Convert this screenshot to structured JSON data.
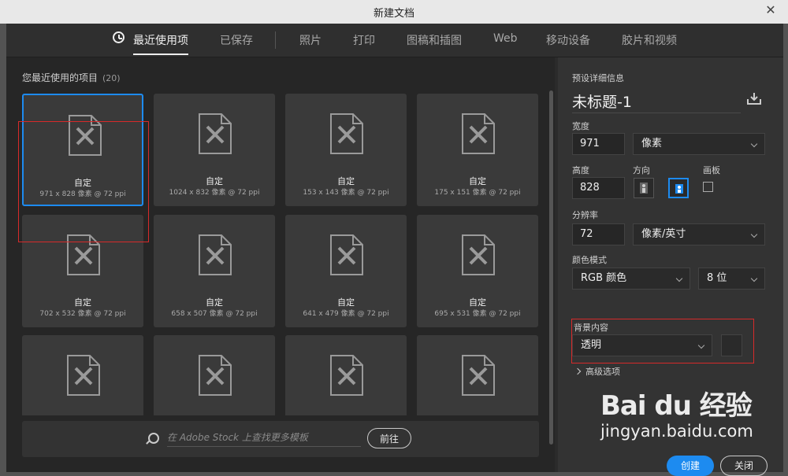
{
  "window": {
    "title": "新建文档",
    "close_glyph": "✕"
  },
  "tabs": [
    {
      "label": "最近使用项",
      "active": true
    },
    {
      "label": "已保存"
    },
    {
      "label": "照片"
    },
    {
      "label": "打印"
    },
    {
      "label": "图稿和插图"
    },
    {
      "label": "Web"
    },
    {
      "label": "移动设备"
    },
    {
      "label": "胶片和视频"
    }
  ],
  "recent": {
    "title": "您最近使用的项目",
    "count": "(20)",
    "items": [
      {
        "name": "自定",
        "info": "971 x 828 像素 @ 72 ppi"
      },
      {
        "name": "自定",
        "info": "1024 x 832 像素 @ 72 ppi"
      },
      {
        "name": "自定",
        "info": "153 x 143 像素 @ 72 ppi"
      },
      {
        "name": "自定",
        "info": "175 x 151 像素 @ 72 ppi"
      },
      {
        "name": "自定",
        "info": "702 x 532 像素 @ 72 ppi"
      },
      {
        "name": "自定",
        "info": "658 x 507 像素 @ 72 ppi"
      },
      {
        "name": "自定",
        "info": "641 x 479 像素 @ 72 ppi"
      },
      {
        "name": "自定",
        "info": "695 x 531 像素 @ 72 ppi"
      },
      {
        "name": "",
        "info": ""
      },
      {
        "name": "",
        "info": ""
      },
      {
        "name": "",
        "info": ""
      },
      {
        "name": "",
        "info": ""
      }
    ]
  },
  "stock": {
    "placeholder": "在 Adobe Stock 上查找更多模板",
    "go_label": "前往"
  },
  "preset": {
    "section_label": "预设详细信息",
    "doc_title": "未标题-1",
    "width_label": "宽度",
    "width_value": "971",
    "width_unit": "像素",
    "height_label": "高度",
    "height_value": "828",
    "orientation_label": "方向",
    "artboard_label": "画板",
    "resolution_label": "分辨率",
    "resolution_value": "72",
    "resolution_unit": "像素/英寸",
    "color_mode_label": "颜色模式",
    "color_mode_value": "RGB 颜色",
    "bit_depth_value": "8 位",
    "background_label": "背景内容",
    "background_value": "透明",
    "advanced_label": "高级选项"
  },
  "buttons": {
    "create": "创建",
    "close": "关闭"
  },
  "watermark": {
    "logo": "Bai du 经验",
    "url": "jingyan.baidu.com"
  },
  "colors": {
    "accent": "#1d8bf0",
    "highlight": "#d62a2a"
  }
}
